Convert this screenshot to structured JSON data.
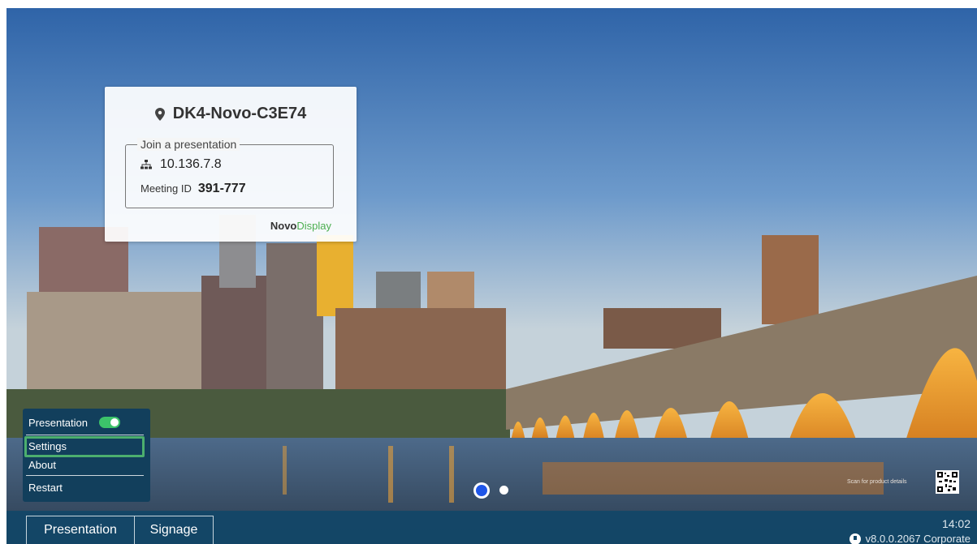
{
  "device": {
    "name": "DK4-Novo-C3E74",
    "join_label": "Join a presentation",
    "ip": "10.136.7.8",
    "meeting_label": "Meeting ID",
    "meeting_id": "391-777",
    "brand_bold": "Novo",
    "brand_light": "Display"
  },
  "menu": {
    "presentation_label": "Presentation",
    "presentation_enabled": true,
    "items": [
      "Settings",
      "About",
      "Restart"
    ],
    "highlighted": "Settings"
  },
  "bottom_bar": {
    "tabs": [
      "Presentation",
      "Signage"
    ],
    "time": "14:02",
    "version": "v8.0.0.2067 Corporate"
  },
  "pager": {
    "count": 2,
    "active_index": 0
  },
  "qr": {
    "label": "Scan for product details"
  },
  "colors": {
    "accent_green": "#4caf50",
    "bar_blue": "#114668",
    "menu_blue": "#123f5c",
    "pager_active": "#1f56e8"
  }
}
